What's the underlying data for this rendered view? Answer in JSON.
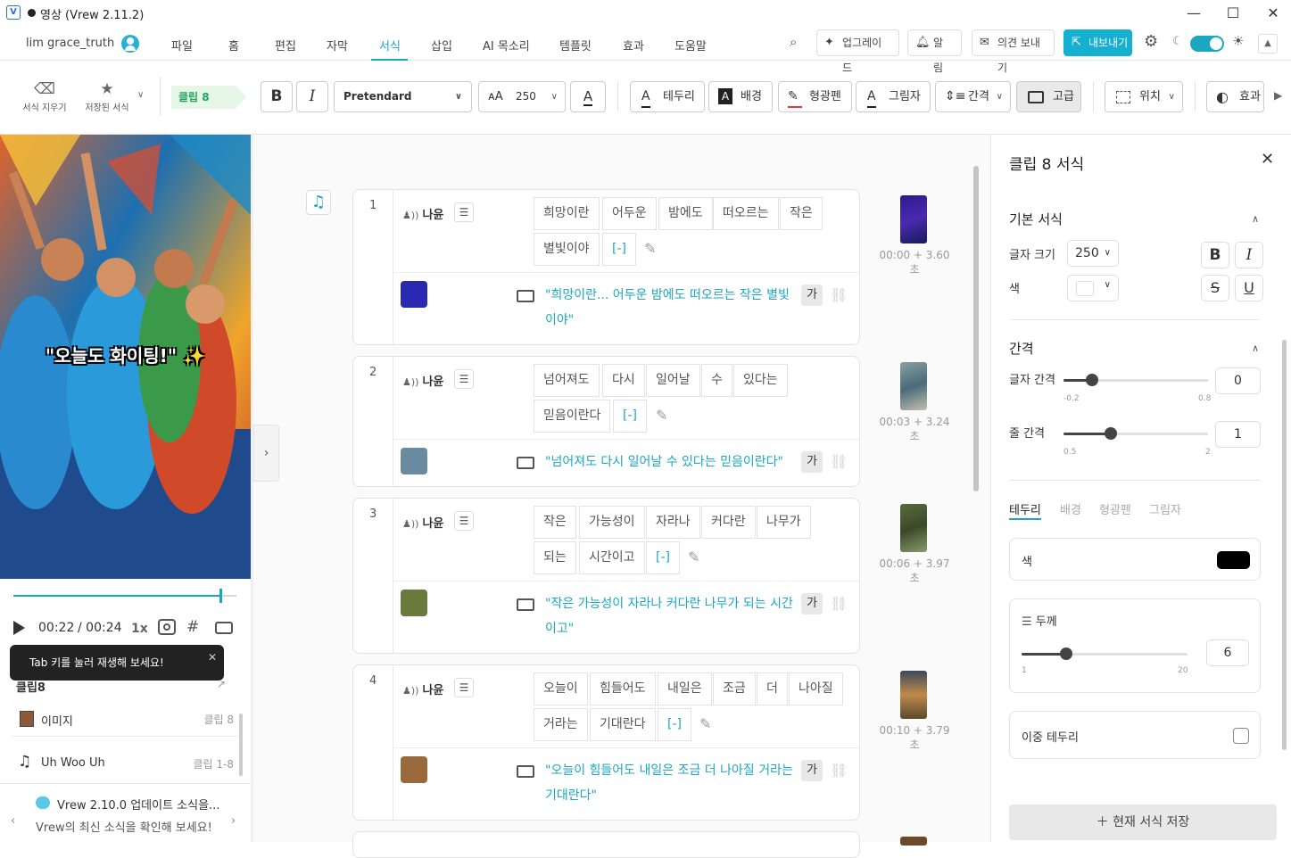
{
  "window": {
    "app_icon_letter": "V",
    "title": "영상 (Vrew 2.11.2)",
    "minimize": "—",
    "maximize": "☐",
    "close": "✕"
  },
  "menu": {
    "user": "lim grace_truth",
    "items": [
      "파일",
      "홈",
      "편집",
      "자막",
      "서식",
      "삽입",
      "AI 목소리",
      "템플릿",
      "효과",
      "도움말"
    ],
    "active": "서식",
    "upgrade": "업그레이드",
    "alert": "알림",
    "feedback": "의견 보내기",
    "export": "내보내기"
  },
  "toolbar": {
    "clear_style": "서식 지우기",
    "saved_style": "저장된 서식",
    "clip_tag": "클립 8",
    "bold": "B",
    "italic": "I",
    "font": "Pretendard",
    "font_size": "250",
    "border": "테두리",
    "background": "배경",
    "highlighter": "형광펜",
    "shadow": "그림자",
    "spacing": "간격",
    "advanced": "고급",
    "position": "위치",
    "effect": "효과"
  },
  "preview": {
    "caption": "\"오늘도 화이팅!\" ✨",
    "time_current": "00:22",
    "time_total": "/ 00:24",
    "speed": "1x",
    "progress": 0.93,
    "tip": "Tab 키를 눌러 재생해 보세요!"
  },
  "assets": {
    "header": "클립8",
    "rows": [
      {
        "name": "이미지",
        "clip": "클립 8"
      },
      {
        "name": "Uh Woo Uh",
        "clip": "클립 1-8"
      }
    ]
  },
  "notice": {
    "title": "Vrew 2.10.0 업데이트 소식을...",
    "subtitle": "Vrew의 최신 소식을 확인해 보세요!"
  },
  "clips": [
    {
      "num": "1",
      "speaker": "나윤",
      "words_line1": [
        "희망이란",
        "어두운",
        "밤에도",
        "떠오르는",
        "작은"
      ],
      "words_line2": [
        "별빛이야",
        "[-]"
      ],
      "subtitle": "\"희망이란... 어두운 밤에도 떠오르는 작은 별빛이야\"",
      "time": "00:00 + 3.60초"
    },
    {
      "num": "2",
      "speaker": "나윤",
      "words_line1": [
        "넘어져도",
        "다시",
        "일어날",
        "수",
        "있다는"
      ],
      "words_line2": [
        "믿음이란다",
        "[-]"
      ],
      "subtitle": "\"넘어져도 다시 일어날 수 있다는 믿음이란다\"",
      "time": "00:03 + 3.24초"
    },
    {
      "num": "3",
      "speaker": "나윤",
      "words_line1": [
        "작은",
        "가능성이",
        "자라나",
        "커다란",
        "나무가"
      ],
      "words_line2": [
        "되는",
        "시간이고",
        "[-]"
      ],
      "subtitle": "\"작은 가능성이 자라나 커다란 나무가 되는 시간이고\"",
      "time": "00:06 + 3.97초"
    },
    {
      "num": "4",
      "speaker": "나윤",
      "words_line1": [
        "오늘이",
        "힘들어도",
        "내일은",
        "조금",
        "더",
        "나아질"
      ],
      "words_line2": [
        "거라는",
        "기대란다",
        "[-]"
      ],
      "subtitle": "\"오늘이 힘들어도 내일은 조금 더 나아질 거라는 기대란다\"",
      "time": "00:10 + 3.79초"
    }
  ],
  "style_panel": {
    "title": "클립 8 서식",
    "basic": "기본 서식",
    "font_size_label": "글자 크기",
    "font_size": "250",
    "color_label": "색",
    "spacing": "간격",
    "letter_spacing_label": "글자 간격",
    "letter_spacing": "0",
    "letter_min": "-0.2",
    "letter_max": "0.8",
    "line_spacing_label": "줄 간격",
    "line_spacing": "1",
    "line_min": "0.5",
    "line_max": "2",
    "tabs": [
      "테두리",
      "배경",
      "형광펜",
      "그림자"
    ],
    "border_color_label": "색",
    "border_color": "#000000",
    "thickness_label": "두께",
    "thickness": "6",
    "thickness_min": "1",
    "thickness_max": "20",
    "double_border": "이중 테두리",
    "save_button": "현재 서식 저장"
  }
}
